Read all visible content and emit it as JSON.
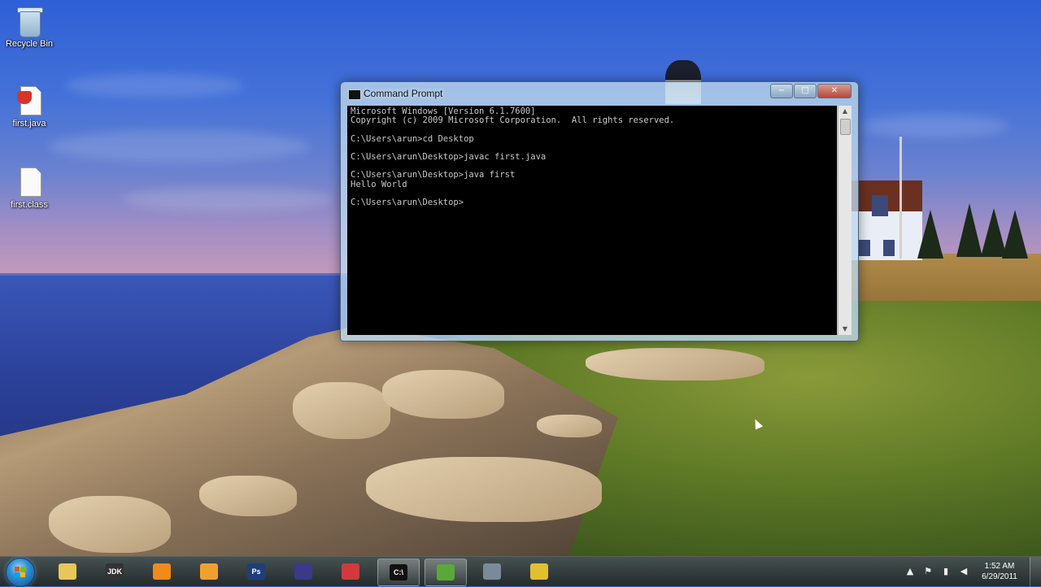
{
  "desktop": {
    "icons": [
      {
        "label": "Recycle Bin",
        "icon": "recycle-bin-icon"
      },
      {
        "label": "first.java",
        "icon": "java-file-icon"
      },
      {
        "label": "first.class",
        "icon": "class-file-icon"
      }
    ]
  },
  "cmd_window": {
    "title": "Command Prompt",
    "buttons": {
      "minimize": "−",
      "maximize": "□",
      "close": "✕"
    },
    "console_lines": [
      "Microsoft Windows [Version 6.1.7600]",
      "Copyright (c) 2009 Microsoft Corporation.  All rights reserved.",
      "",
      "C:\\Users\\arun>cd Desktop",
      "",
      "C:\\Users\\arun\\Desktop>javac first.java",
      "",
      "C:\\Users\\arun\\Desktop>java first",
      "Hello World",
      "",
      "C:\\Users\\arun\\Desktop>"
    ],
    "scroll_up": "▲",
    "scroll_down": "▼"
  },
  "taskbar": {
    "pinned": [
      {
        "name": "explorer-taskbar-button",
        "icon": "folder-icon",
        "text": "",
        "color": "#e8c75a",
        "active": false
      },
      {
        "name": "jdk-taskbar-button",
        "icon": "jdk-icon",
        "text": "JDK",
        "color": "#333333",
        "active": false
      },
      {
        "name": "vlc-taskbar-button",
        "icon": "vlc-icon",
        "text": "",
        "color": "#f08a1c",
        "active": false
      },
      {
        "name": "app-taskbar-button",
        "icon": "app-icon",
        "text": "",
        "color": "#f0a030",
        "active": false
      },
      {
        "name": "photoshop-taskbar-button",
        "icon": "photoshop-icon",
        "text": "Ps",
        "color": "#1d3f7a",
        "active": false
      },
      {
        "name": "eclipse-taskbar-button",
        "icon": "eclipse-icon",
        "text": "",
        "color": "#3a3a8a",
        "active": false
      },
      {
        "name": "media-taskbar-button",
        "icon": "media-icon",
        "text": "",
        "color": "#d03a3a",
        "active": false
      },
      {
        "name": "cmd-taskbar-button",
        "icon": "cmd-icon",
        "text": "C:\\",
        "color": "#111111",
        "active": true
      },
      {
        "name": "notepad-taskbar-button",
        "icon": "notepad-icon",
        "text": "",
        "color": "#5aa83a",
        "active": true
      },
      {
        "name": "settings-taskbar-button",
        "icon": "gear-icon",
        "text": "",
        "color": "#7a8a9a",
        "active": false
      },
      {
        "name": "chrome-taskbar-button",
        "icon": "chrome-icon",
        "text": "",
        "color": "#e0c030",
        "active": false
      }
    ],
    "tray_icons": [
      {
        "name": "show-hidden-icons",
        "glyph": "▲"
      },
      {
        "name": "action-center-icon",
        "glyph": "⚑"
      },
      {
        "name": "network-icon",
        "glyph": "▮"
      },
      {
        "name": "volume-icon",
        "glyph": "◀"
      }
    ],
    "clock": {
      "time": "1:52 AM",
      "date": "6/29/2011"
    }
  }
}
